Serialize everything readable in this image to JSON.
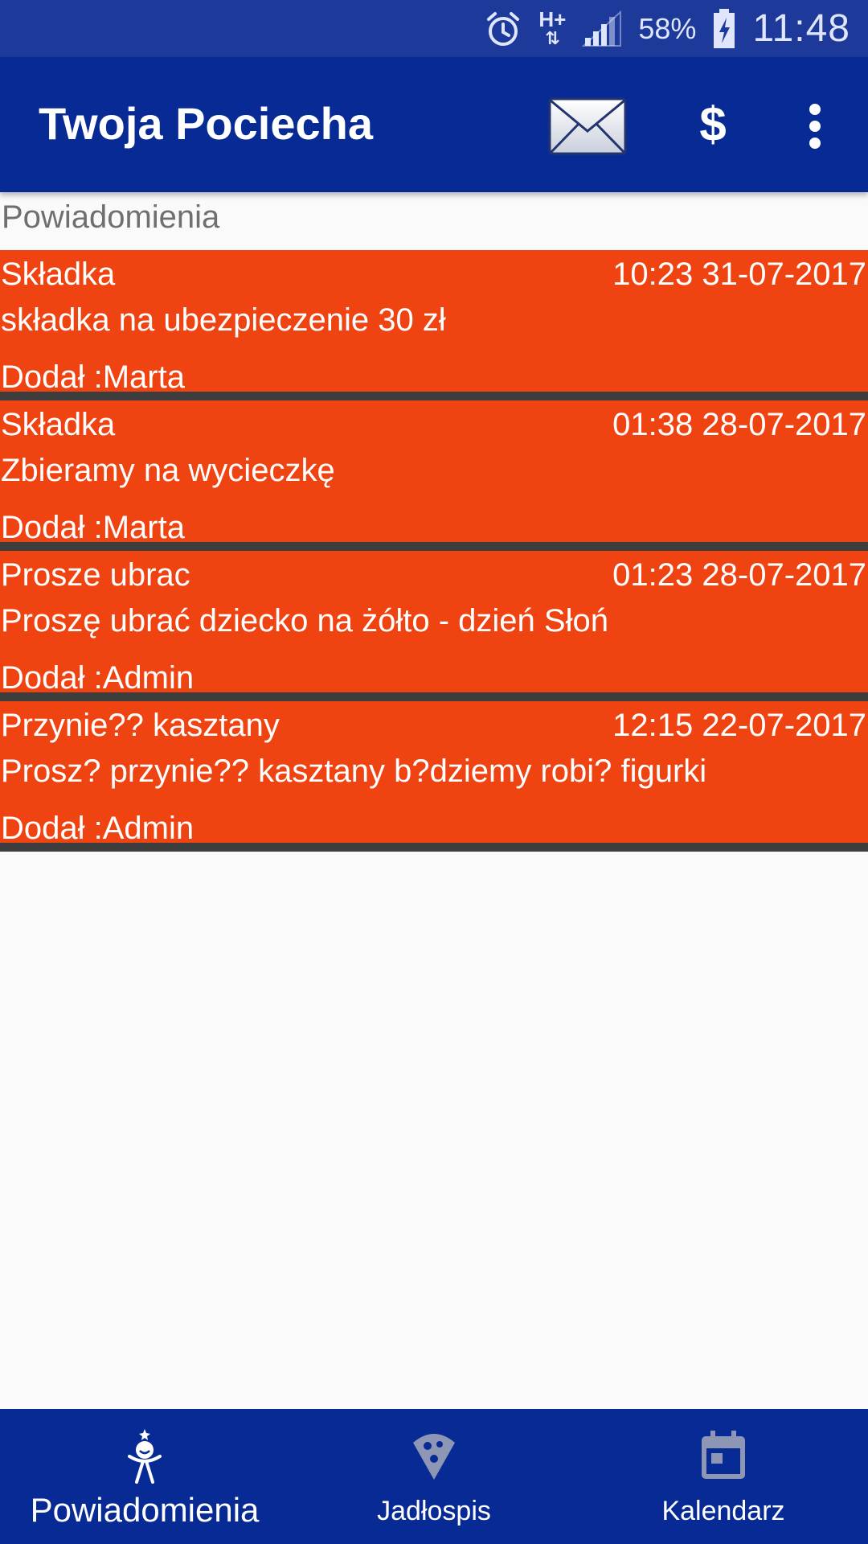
{
  "status_bar": {
    "network": "H+",
    "battery": "58%",
    "time": "11:48"
  },
  "app_bar": {
    "title": "Twoja Pociecha",
    "actions": {
      "mail_icon": "envelope-icon",
      "payment_label": "$",
      "menu_icon": "more-vertical-icon"
    }
  },
  "section": {
    "title": "Powiadomienia"
  },
  "notifications": [
    {
      "title": "Składka",
      "date": "10:23 31-07-2017",
      "body": "składka na ubezpieczenie 30 zł",
      "author": "Dodał :Marta"
    },
    {
      "title": "Składka",
      "date": "01:38 28-07-2017",
      "body": "Zbieramy na wycieczkę",
      "author": "Dodał :Marta"
    },
    {
      "title": "Prosze ubrac",
      "date": "01:23 28-07-2017",
      "body": "Proszę ubrać dziecko na żółto - dzień Słoń",
      "author": "Dodał :Admin"
    },
    {
      "title": "Przynie?? kasztany",
      "date": "12:15 22-07-2017",
      "body": "Prosz? przynie?? kasztany b?dziemy robi? figurki",
      "author": "Dodał :Admin"
    }
  ],
  "bottom_nav": [
    {
      "label": "Powiadomienia",
      "icon": "child-icon",
      "active": true
    },
    {
      "label": "Jadłospis",
      "icon": "pizza-icon",
      "active": false
    },
    {
      "label": "Kalendarz",
      "icon": "calendar-icon",
      "active": false
    }
  ],
  "colors": {
    "status_bar": "#1d3a9a",
    "primary": "#072a94",
    "card": "#ef4411",
    "card_divider": "#3d3d3d",
    "background": "#fafafa"
  }
}
